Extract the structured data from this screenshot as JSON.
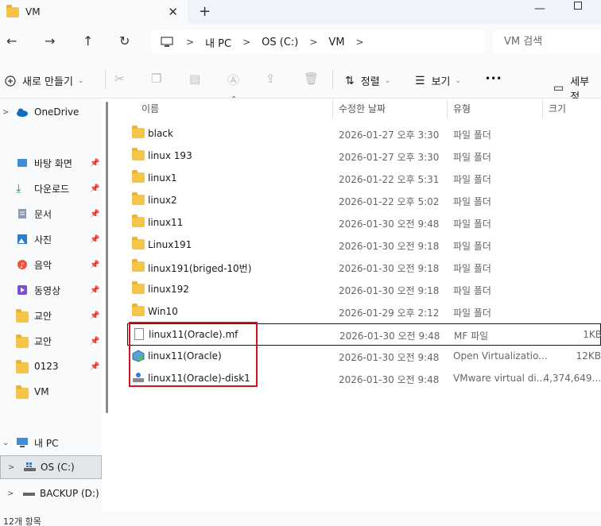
{
  "tab": {
    "title": "VM",
    "close": "✕",
    "add": "+"
  },
  "window": {
    "minimize": "—"
  },
  "nav": {
    "back": "←",
    "forward": "→",
    "up": "↑",
    "refresh": "↻",
    "breadcrumb": [
      "내 PC",
      "OS (C:)",
      "VM"
    ],
    "search_placeholder": "VM 검색"
  },
  "commands": {
    "new_label": "새로 만들기",
    "sort_label": "정렬",
    "view_label": "보기",
    "more": "•••",
    "details_label": "세부 정"
  },
  "sidebar": {
    "items": [
      {
        "label": "OneDrive",
        "pinned": false
      },
      {
        "label": "바탕 화면",
        "pinned": true
      },
      {
        "label": "다운로드",
        "pinned": true
      },
      {
        "label": "문서",
        "pinned": true
      },
      {
        "label": "사진",
        "pinned": true
      },
      {
        "label": "음악",
        "pinned": true
      },
      {
        "label": "동영상",
        "pinned": true
      },
      {
        "label": "교안",
        "pinned": true
      },
      {
        "label": "교안",
        "pinned": true
      },
      {
        "label": "0123",
        "pinned": true
      },
      {
        "label": "VM",
        "pinned": false
      },
      {
        "label": "내 PC",
        "pinned": false
      },
      {
        "label": "OS (C:)",
        "pinned": false
      },
      {
        "label": "BACKUP (D:)",
        "pinned": false
      }
    ]
  },
  "columns": {
    "name": "이름",
    "date": "수정한 날짜",
    "type": "유형",
    "size": "크기"
  },
  "files": [
    {
      "name": "black",
      "date": "2026-01-27 오후 3:30",
      "type": "파일 폴더",
      "size": ""
    },
    {
      "name": "linux 193",
      "date": "2026-01-27 오후 3:30",
      "type": "파일 폴더",
      "size": ""
    },
    {
      "name": "linux1",
      "date": "2026-01-22 오후 5:31",
      "type": "파일 폴더",
      "size": ""
    },
    {
      "name": "linux2",
      "date": "2026-01-22 오후 5:02",
      "type": "파일 폴더",
      "size": ""
    },
    {
      "name": "linux11",
      "date": "2026-01-30 오전 9:48",
      "type": "파일 폴더",
      "size": ""
    },
    {
      "name": "Linux191",
      "date": "2026-01-30 오전 9:18",
      "type": "파일 폴더",
      "size": ""
    },
    {
      "name": "linux191(briged-10번)",
      "date": "2026-01-30 오전 9:18",
      "type": "파일 폴더",
      "size": ""
    },
    {
      "name": "linux192",
      "date": "2026-01-30 오전 9:18",
      "type": "파일 폴더",
      "size": ""
    },
    {
      "name": "Win10",
      "date": "2026-01-29 오후 2:12",
      "type": "파일 폴더",
      "size": ""
    },
    {
      "name": "linux11(Oracle).mf",
      "date": "2026-01-30 오전 9:48",
      "type": "MF 파일",
      "size": "1KB"
    },
    {
      "name": "linux11(Oracle)",
      "date": "2026-01-30 오전 9:48",
      "type": "Open Virtualizatio...",
      "size": "12KB"
    },
    {
      "name": "linux11(Oracle)-disk1",
      "date": "2026-01-30 오전 9:48",
      "type": "VMware virtual di...",
      "size": "4,374,649..."
    }
  ],
  "status": {
    "count": "12개 항목"
  },
  "colors": {
    "folder": "#f4c54a",
    "highlight": "#d0161a",
    "accent": "#0067c0"
  }
}
